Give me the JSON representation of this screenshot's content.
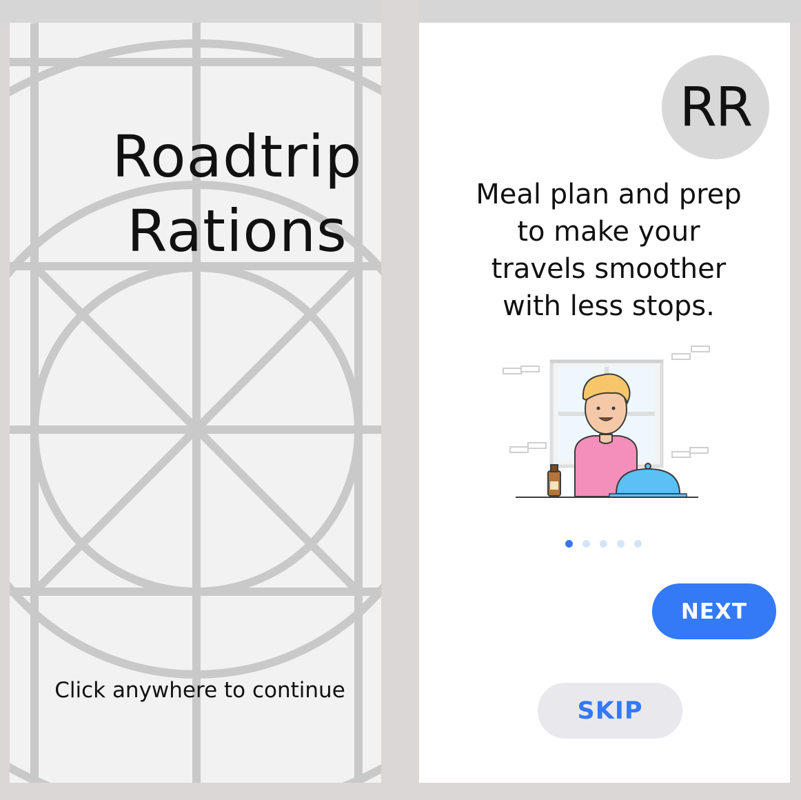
{
  "splash": {
    "title_line1": "Roadtrip",
    "title_line2": "Rations",
    "continue_hint": "Click anywhere to continue"
  },
  "onboarding": {
    "avatar_initials": "RR",
    "tagline_lines": [
      "Meal plan and prep",
      "to make your",
      "travels smoother",
      "with less stops."
    ],
    "page_indicator": {
      "count": 5,
      "active_index": 0
    },
    "next_label": "NEXT",
    "skip_label": "SKIP"
  },
  "colors": {
    "accent": "#3479f6",
    "background": "#dcd7d7",
    "splash_bg": "#f2f2f2",
    "card_bg": "#ffffff",
    "skip_bg": "#e9e9ed",
    "avatar_bg": "#d8d8d8"
  },
  "icons": {
    "illustration": "person-with-dinner-illustration"
  }
}
